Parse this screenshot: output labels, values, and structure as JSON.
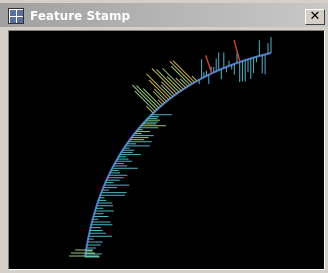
{
  "window": {
    "title": "Feature Stamp",
    "close_glyph": "✕",
    "app_icon": "feature-stamp-app-icon"
  },
  "canvas": {
    "background": "#000000",
    "curve_color": "#5078c8",
    "feature_colors": [
      "#50b4c8",
      "#96c878",
      "#c8b450",
      "#c84632",
      "#64a0d2"
    ]
  }
}
